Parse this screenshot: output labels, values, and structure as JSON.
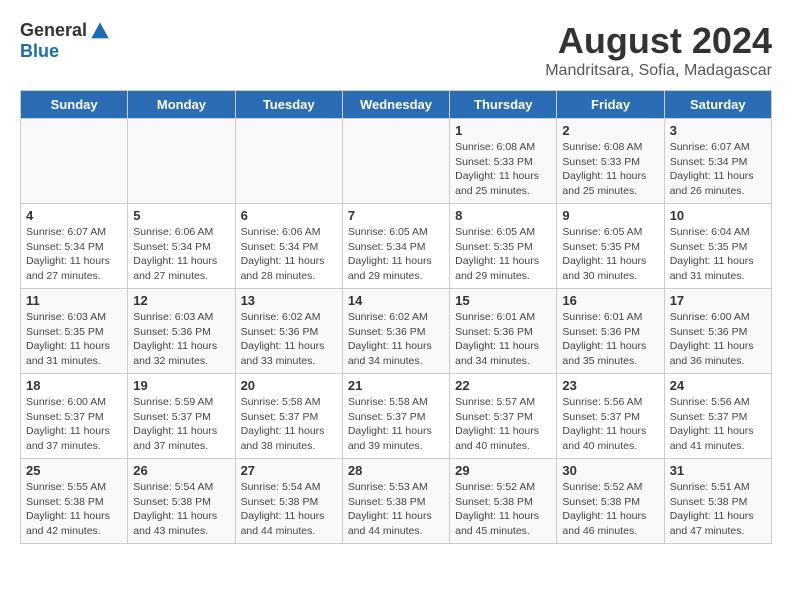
{
  "logo": {
    "general": "General",
    "blue": "Blue"
  },
  "title": "August 2024",
  "subtitle": "Mandritsara, Sofia, Madagascar",
  "days_header": [
    "Sunday",
    "Monday",
    "Tuesday",
    "Wednesday",
    "Thursday",
    "Friday",
    "Saturday"
  ],
  "weeks": [
    [
      {
        "day": "",
        "info": ""
      },
      {
        "day": "",
        "info": ""
      },
      {
        "day": "",
        "info": ""
      },
      {
        "day": "",
        "info": ""
      },
      {
        "day": "1",
        "info": "Sunrise: 6:08 AM\nSunset: 5:33 PM\nDaylight: 11 hours\nand 25 minutes."
      },
      {
        "day": "2",
        "info": "Sunrise: 6:08 AM\nSunset: 5:33 PM\nDaylight: 11 hours\nand 25 minutes."
      },
      {
        "day": "3",
        "info": "Sunrise: 6:07 AM\nSunset: 5:34 PM\nDaylight: 11 hours\nand 26 minutes."
      }
    ],
    [
      {
        "day": "4",
        "info": "Sunrise: 6:07 AM\nSunset: 5:34 PM\nDaylight: 11 hours\nand 27 minutes."
      },
      {
        "day": "5",
        "info": "Sunrise: 6:06 AM\nSunset: 5:34 PM\nDaylight: 11 hours\nand 27 minutes."
      },
      {
        "day": "6",
        "info": "Sunrise: 6:06 AM\nSunset: 5:34 PM\nDaylight: 11 hours\nand 28 minutes."
      },
      {
        "day": "7",
        "info": "Sunrise: 6:05 AM\nSunset: 5:34 PM\nDaylight: 11 hours\nand 29 minutes."
      },
      {
        "day": "8",
        "info": "Sunrise: 6:05 AM\nSunset: 5:35 PM\nDaylight: 11 hours\nand 29 minutes."
      },
      {
        "day": "9",
        "info": "Sunrise: 6:05 AM\nSunset: 5:35 PM\nDaylight: 11 hours\nand 30 minutes."
      },
      {
        "day": "10",
        "info": "Sunrise: 6:04 AM\nSunset: 5:35 PM\nDaylight: 11 hours\nand 31 minutes."
      }
    ],
    [
      {
        "day": "11",
        "info": "Sunrise: 6:03 AM\nSunset: 5:35 PM\nDaylight: 11 hours\nand 31 minutes."
      },
      {
        "day": "12",
        "info": "Sunrise: 6:03 AM\nSunset: 5:36 PM\nDaylight: 11 hours\nand 32 minutes."
      },
      {
        "day": "13",
        "info": "Sunrise: 6:02 AM\nSunset: 5:36 PM\nDaylight: 11 hours\nand 33 minutes."
      },
      {
        "day": "14",
        "info": "Sunrise: 6:02 AM\nSunset: 5:36 PM\nDaylight: 11 hours\nand 34 minutes."
      },
      {
        "day": "15",
        "info": "Sunrise: 6:01 AM\nSunset: 5:36 PM\nDaylight: 11 hours\nand 34 minutes."
      },
      {
        "day": "16",
        "info": "Sunrise: 6:01 AM\nSunset: 5:36 PM\nDaylight: 11 hours\nand 35 minutes."
      },
      {
        "day": "17",
        "info": "Sunrise: 6:00 AM\nSunset: 5:36 PM\nDaylight: 11 hours\nand 36 minutes."
      }
    ],
    [
      {
        "day": "18",
        "info": "Sunrise: 6:00 AM\nSunset: 5:37 PM\nDaylight: 11 hours\nand 37 minutes."
      },
      {
        "day": "19",
        "info": "Sunrise: 5:59 AM\nSunset: 5:37 PM\nDaylight: 11 hours\nand 37 minutes."
      },
      {
        "day": "20",
        "info": "Sunrise: 5:58 AM\nSunset: 5:37 PM\nDaylight: 11 hours\nand 38 minutes."
      },
      {
        "day": "21",
        "info": "Sunrise: 5:58 AM\nSunset: 5:37 PM\nDaylight: 11 hours\nand 39 minutes."
      },
      {
        "day": "22",
        "info": "Sunrise: 5:57 AM\nSunset: 5:37 PM\nDaylight: 11 hours\nand 40 minutes."
      },
      {
        "day": "23",
        "info": "Sunrise: 5:56 AM\nSunset: 5:37 PM\nDaylight: 11 hours\nand 40 minutes."
      },
      {
        "day": "24",
        "info": "Sunrise: 5:56 AM\nSunset: 5:37 PM\nDaylight: 11 hours\nand 41 minutes."
      }
    ],
    [
      {
        "day": "25",
        "info": "Sunrise: 5:55 AM\nSunset: 5:38 PM\nDaylight: 11 hours\nand 42 minutes."
      },
      {
        "day": "26",
        "info": "Sunrise: 5:54 AM\nSunset: 5:38 PM\nDaylight: 11 hours\nand 43 minutes."
      },
      {
        "day": "27",
        "info": "Sunrise: 5:54 AM\nSunset: 5:38 PM\nDaylight: 11 hours\nand 44 minutes."
      },
      {
        "day": "28",
        "info": "Sunrise: 5:53 AM\nSunset: 5:38 PM\nDaylight: 11 hours\nand 44 minutes."
      },
      {
        "day": "29",
        "info": "Sunrise: 5:52 AM\nSunset: 5:38 PM\nDaylight: 11 hours\nand 45 minutes."
      },
      {
        "day": "30",
        "info": "Sunrise: 5:52 AM\nSunset: 5:38 PM\nDaylight: 11 hours\nand 46 minutes."
      },
      {
        "day": "31",
        "info": "Sunrise: 5:51 AM\nSunset: 5:38 PM\nDaylight: 11 hours\nand 47 minutes."
      }
    ]
  ]
}
